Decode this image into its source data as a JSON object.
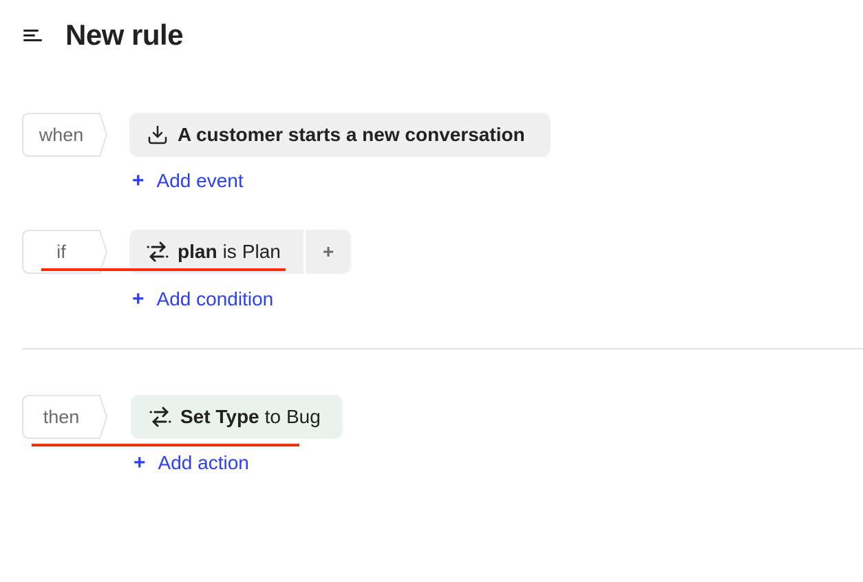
{
  "header": {
    "menu_icon": "hamburger-menu-icon",
    "title": "New rule"
  },
  "when": {
    "label": "when",
    "event": {
      "icon": "download-icon",
      "text": "A customer starts a new conversation"
    },
    "add_label": "Add event",
    "add_icon": "+"
  },
  "if": {
    "label": "if",
    "condition": {
      "icon": "swap-arrows-icon",
      "field": "plan",
      "operator": "is",
      "value": "Plan"
    },
    "plus_button": "+",
    "add_label": "Add condition",
    "add_icon": "+"
  },
  "then": {
    "label": "then",
    "action": {
      "icon": "swap-arrows-icon",
      "field": "Set Type",
      "operator": "to",
      "value": "Bug"
    },
    "add_label": "Add action",
    "add_icon": "+"
  },
  "colors": {
    "link_blue": "#2b3ff5",
    "annotation_red": "#ff2a06",
    "chip_gray": "#f0f0f0",
    "chip_green": "#eaf4ec"
  }
}
